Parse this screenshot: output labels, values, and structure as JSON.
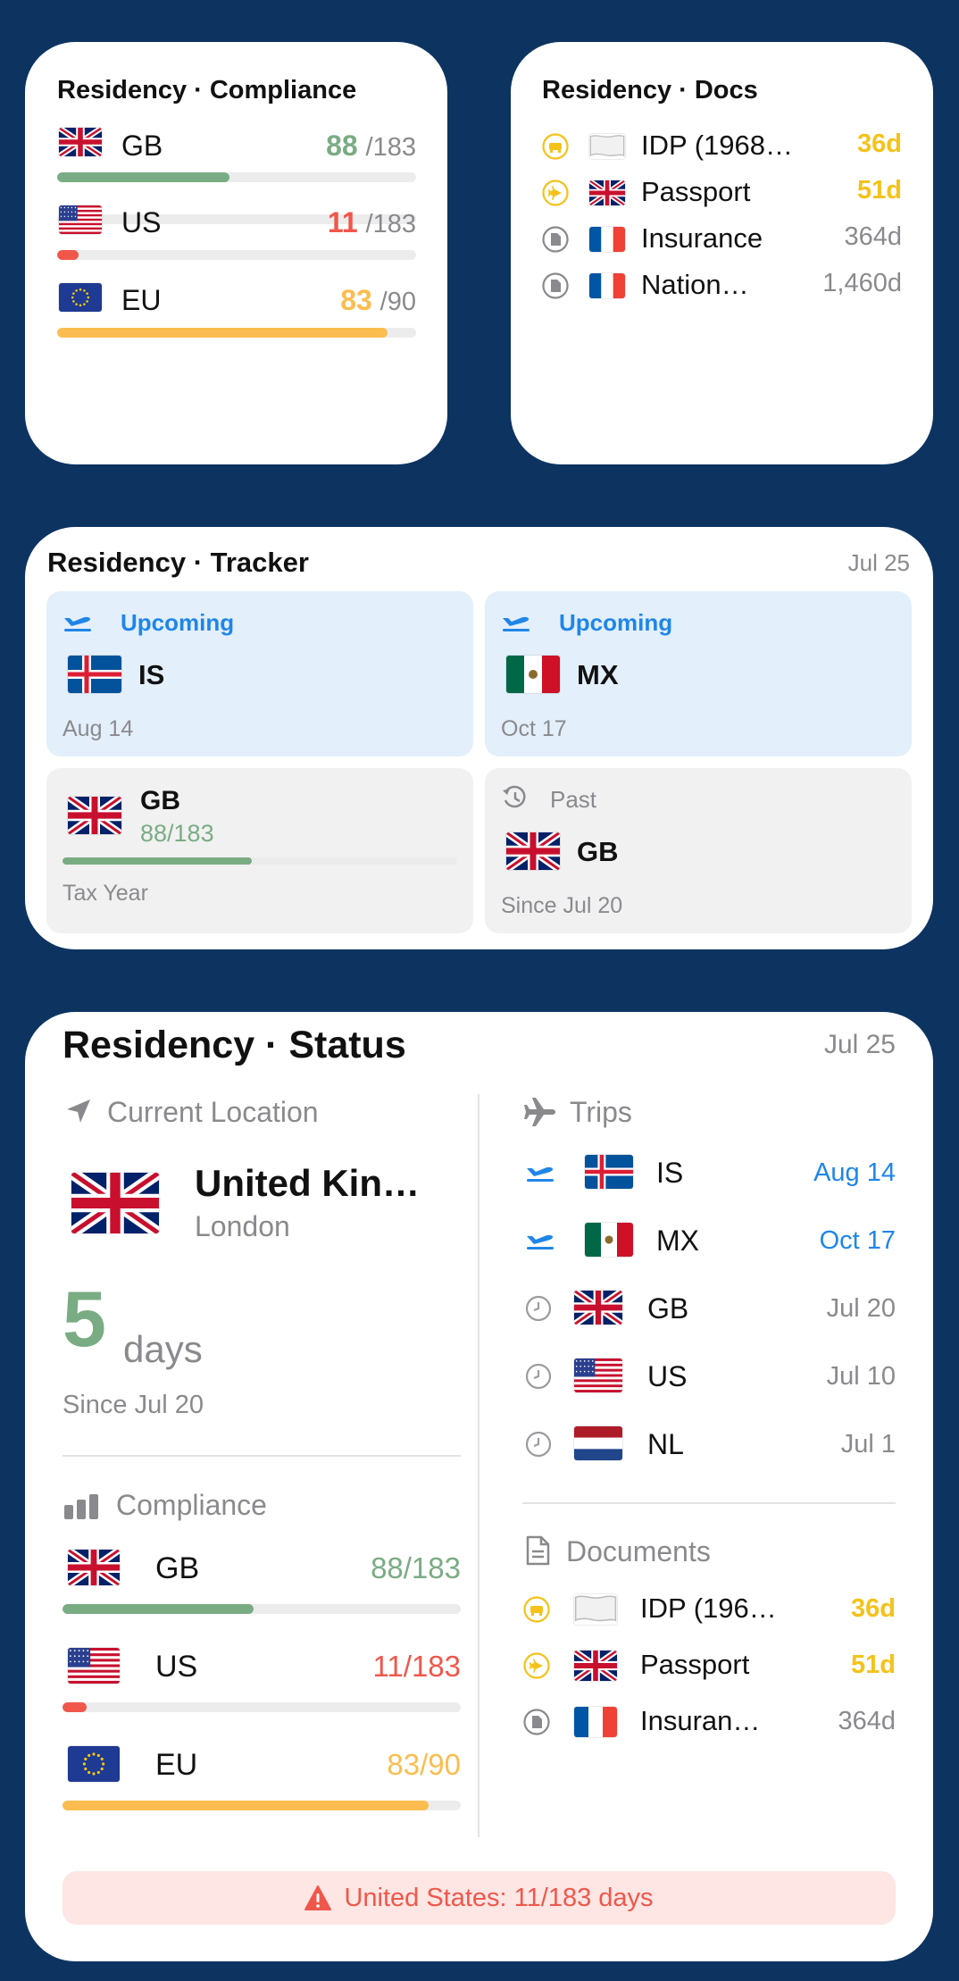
{
  "compliance_widget": {
    "title": "Residency · Compliance",
    "rows": [
      {
        "code": "GB",
        "value": "88",
        "limit": "/183",
        "progress": 0.48,
        "color": "#7aac84"
      },
      {
        "code": "US",
        "value": "11",
        "limit": "/183",
        "progress": 0.06,
        "color": "#f0574b"
      },
      {
        "code": "EU",
        "value": "83",
        "limit": "/90",
        "progress": 0.92,
        "color": "#fbbd4f"
      }
    ]
  },
  "docs_widget": {
    "title": "Residency · Docs",
    "rows": [
      {
        "icon": "car-icon",
        "flag": "blank",
        "name": "IDP (1968…",
        "days": "36d",
        "color": "#f4c21a"
      },
      {
        "icon": "plane-icon",
        "flag": "GB",
        "name": "Passport",
        "days": "51d",
        "color": "#f4c21a"
      },
      {
        "icon": "document-icon",
        "flag": "FR",
        "name": "Insurance",
        "days": "364d",
        "color": "#8a8a8e"
      },
      {
        "icon": "document-icon",
        "flag": "FR",
        "name": "Nation…",
        "days": "1,460d",
        "color": "#8a8a8e"
      }
    ]
  },
  "tracker_widget": {
    "title": "Residency · Tracker",
    "date": "Jul 25",
    "tiles": [
      {
        "kind": "upcoming",
        "label": "Upcoming",
        "code": "IS",
        "sub": "Aug 14"
      },
      {
        "kind": "upcoming",
        "label": "Upcoming",
        "code": "MX",
        "sub": "Oct 17"
      },
      {
        "kind": "stat",
        "code": "GB",
        "value": "88/183",
        "progress": 0.48,
        "sub": "Tax Year"
      },
      {
        "kind": "past",
        "label": "Past",
        "code": "GB",
        "sub": "Since Jul 20"
      }
    ]
  },
  "status_widget": {
    "title": "Residency · Status",
    "date": "Jul 25",
    "current_location_label": "Current Location",
    "country": "United Kin…",
    "city": "London",
    "days_number": "5",
    "days_word": "days",
    "since": "Since Jul 20",
    "compliance_label": "Compliance",
    "compliance": [
      {
        "code": "GB",
        "value": "88/183",
        "progress": 0.48,
        "color": "#7aac84"
      },
      {
        "code": "US",
        "value": "11/183",
        "progress": 0.06,
        "color": "#f0574b"
      },
      {
        "code": "EU",
        "value": "83/90",
        "progress": 0.92,
        "color": "#fbbd4f"
      }
    ],
    "trips_label": "Trips",
    "trips": [
      {
        "icon": "departure-icon",
        "code": "IS",
        "date": "Aug 14",
        "color": "#1f86e8"
      },
      {
        "icon": "departure-icon",
        "code": "MX",
        "date": "Oct 17",
        "color": "#1f86e8"
      },
      {
        "icon": "clock-icon",
        "code": "GB",
        "date": "Jul 20",
        "color": "#8a8a8e"
      },
      {
        "icon": "clock-icon",
        "code": "US",
        "date": "Jul 10",
        "color": "#8a8a8e"
      },
      {
        "icon": "clock-icon",
        "code": "NL",
        "date": "Jul 1",
        "color": "#8a8a8e"
      }
    ],
    "documents_label": "Documents",
    "documents": [
      {
        "icon": "car-icon",
        "flag": "blank",
        "name": "IDP (196…",
        "days": "36d",
        "color": "#f4c21a"
      },
      {
        "icon": "plane-icon",
        "flag": "GB",
        "name": "Passport",
        "days": "51d",
        "color": "#f4c21a"
      },
      {
        "icon": "document-icon",
        "flag": "FR",
        "name": "Insuran…",
        "days": "364d",
        "color": "#8a8a8e"
      }
    ],
    "alert": "United States: 11/183 days"
  }
}
